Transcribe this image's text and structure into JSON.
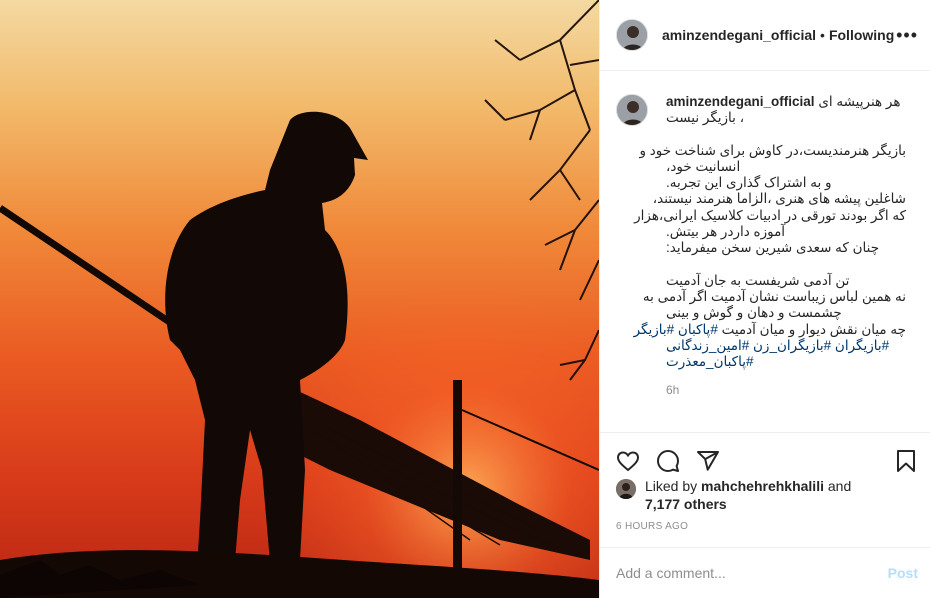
{
  "post": {
    "username": "aminzendegani_official",
    "follow_separator": "•",
    "follow_status": "Following",
    "more_icon": "more-horizontal-icon"
  },
  "caption": {
    "username": "aminzendegani_official",
    "lines": [
      "هر هنرپیشه ای",
      "بازیگر نیست ،",
      "",
      "بازیگر هنرمندیست،در کاوش برای شناخت خود و",
      "انسانیت خود،",
      "و به اشتراک گذاری این تجربه.",
      "شاغلین پیشه های هنری ،الزاما هنرمند نیستند،",
      "که اگر بودند تورقی در ادبیات کلاسیک ایرانی،هزار",
      "آموزه داردر هر بیتش.",
      "چنان که سعدی شیرین سخن میفرماید:",
      "",
      "تن آدمی شریفست به جان آدمیت",
      "نه همین لباس زیباست نشان آدمیت  اگر آدمی به",
      "چشمست و دهان و گوش و بینی",
      "چه میان نقش دیوار و میان آدمیت"
    ],
    "hashtags_inline": "#پاکبان #بازیگر",
    "hashtags": [
      "#بازیگران #بازیگران_زن #امین_زندگانی",
      "#پاکبان_معذرت"
    ],
    "time": "6h"
  },
  "actions": {
    "like_icon": "heart-icon",
    "comment_icon": "comment-icon",
    "share_icon": "share-icon",
    "save_icon": "bookmark-icon"
  },
  "likes": {
    "prefix": "Liked by",
    "by_user": "mahchehrehkhalili",
    "and": "and",
    "others": "7,177 others"
  },
  "timestamp": "6 HOURS AGO",
  "add_comment": {
    "placeholder": "Add a comment...",
    "post_label": "Post",
    "post_color": "#b2dffc"
  },
  "colors": {
    "hashtag": "#00376b",
    "muted": "#8e8e8e",
    "text": "#262626",
    "border": "#efefef"
  }
}
